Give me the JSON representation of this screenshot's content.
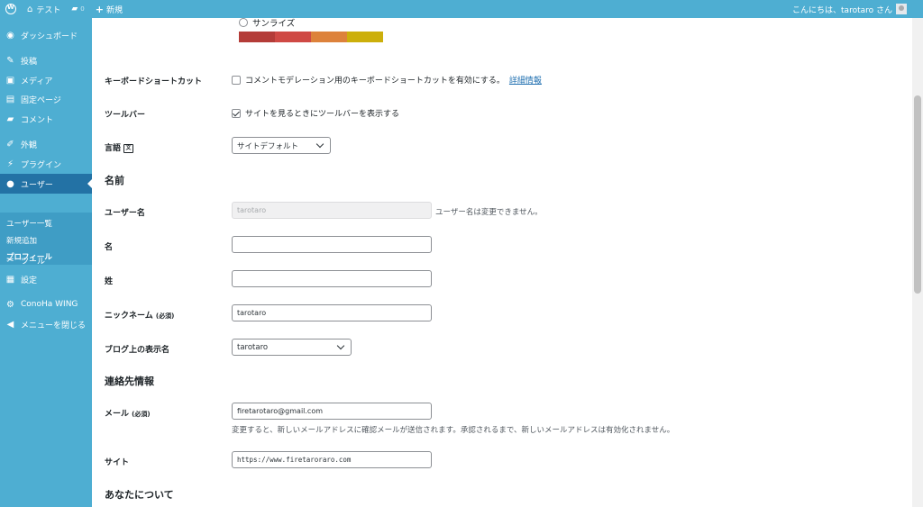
{
  "adminbar": {
    "site_name": "テスト",
    "comments_count": "0",
    "new_label": "新規",
    "greeting": "こんにちは、tarotaro さん"
  },
  "sidebar": {
    "items": [
      {
        "label": "ダッシュボード",
        "icon": "dashboard-icon"
      },
      {
        "label": "投稿",
        "icon": "pin-icon"
      },
      {
        "label": "メディア",
        "icon": "media-icon"
      },
      {
        "label": "固定ページ",
        "icon": "page-icon"
      },
      {
        "label": "コメント",
        "icon": "comment-icon"
      },
      {
        "label": "外観",
        "icon": "brush-icon"
      },
      {
        "label": "プラグイン",
        "icon": "plugin-icon"
      },
      {
        "label": "ユーザー",
        "icon": "user-icon"
      },
      {
        "label": "ツール",
        "icon": "wrench-icon"
      },
      {
        "label": "設定",
        "icon": "settings-icon"
      },
      {
        "label": "ConoHa WING",
        "icon": "gear-icon"
      },
      {
        "label": "メニューを閉じる",
        "icon": "collapse-icon"
      }
    ],
    "submenu": [
      "ユーザー一覧",
      "新規追加",
      "プロフィール"
    ]
  },
  "content": {
    "color_scheme_option": "サンライズ",
    "color_swatches": [
      "#b43c38",
      "#cf4944",
      "#dd823b",
      "#ccaf0b"
    ],
    "keyboard_label": "キーボードショートカット",
    "keyboard_text": "コメントモデレーション用のキーボードショートカットを有効にする。",
    "keyboard_link": "詳細情報",
    "toolbar_label": "ツールバー",
    "toolbar_text": "サイトを見るときにツールバーを表示する",
    "language_label": "言語",
    "language_value": "サイトデフォルト",
    "name_section": "名前",
    "username_label": "ユーザー名",
    "username_value": "tarotaro",
    "username_desc": "ユーザー名は変更できません。",
    "first_name_label": "名",
    "last_name_label": "姓",
    "nickname_label": "ニックネーム",
    "required": "(必須)",
    "nickname_value": "tarotaro",
    "display_name_label": "ブログ上の表示名",
    "display_name_value": "tarotaro",
    "contact_section": "連絡先情報",
    "email_label": "メール",
    "email_value": "firetarotaro@gmail.com",
    "email_desc": "変更すると、新しいメールアドレスに確認メールが送信されます。承認されるまで、新しいメールアドレスは有効化されません。",
    "site_label": "サイト",
    "site_value": "https://www.firetaroraro.com",
    "about_section": "あなたについて"
  }
}
